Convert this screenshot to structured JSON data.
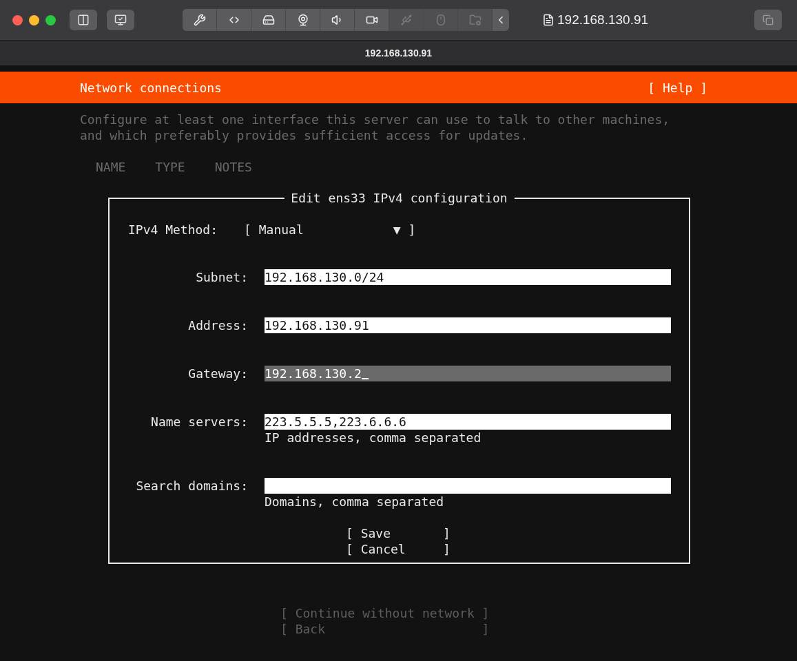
{
  "window": {
    "tab_title": "192.168.130.91",
    "title": "192.168.130.91"
  },
  "toolbar": [
    {
      "disabled": false
    },
    {
      "disabled": false
    },
    {
      "disabled": false
    },
    {
      "disabled": false
    },
    {
      "disabled": false
    },
    {
      "disabled": false
    },
    {
      "disabled": true
    },
    {
      "disabled": true
    },
    {
      "disabled": true
    }
  ],
  "header": {
    "title": "Network connections",
    "help": "[ Help ]"
  },
  "description": [
    "Configure at least one interface this server can use to talk to other machines,",
    "and which preferably provides sufficient access for updates."
  ],
  "table": {
    "columns": [
      "NAME",
      "TYPE",
      "NOTES"
    ]
  },
  "dialog": {
    "title": "Edit ens33 IPv4 configuration",
    "method": {
      "label": "IPv4 Method:",
      "value": "[ Manual            ▼ ]"
    },
    "fields": [
      {
        "label": "Subnet:",
        "value": "192.168.130.0/24",
        "focused": false
      },
      {
        "label": "Address:",
        "value": "192.168.130.91",
        "focused": false
      },
      {
        "label": "Gateway:",
        "value": "192.168.130.2",
        "focused": true
      },
      {
        "label": "Name servers:",
        "value": "223.5.5.5,223.6.6.6",
        "focused": false,
        "help": "IP addresses, comma separated"
      },
      {
        "label": "Search domains:",
        "focused": false,
        "help": "Domains, comma separated"
      }
    ],
    "buttons": [
      {
        "label": "[ Save       ]",
        "disabled": false
      },
      {
        "label": "[ Cancel     ]",
        "disabled": false
      }
    ]
  },
  "footer_buttons": [
    {
      "label": "[ Continue without network ]",
      "disabled": true
    },
    {
      "label": "[ Back                     ]",
      "disabled": true
    }
  ]
}
